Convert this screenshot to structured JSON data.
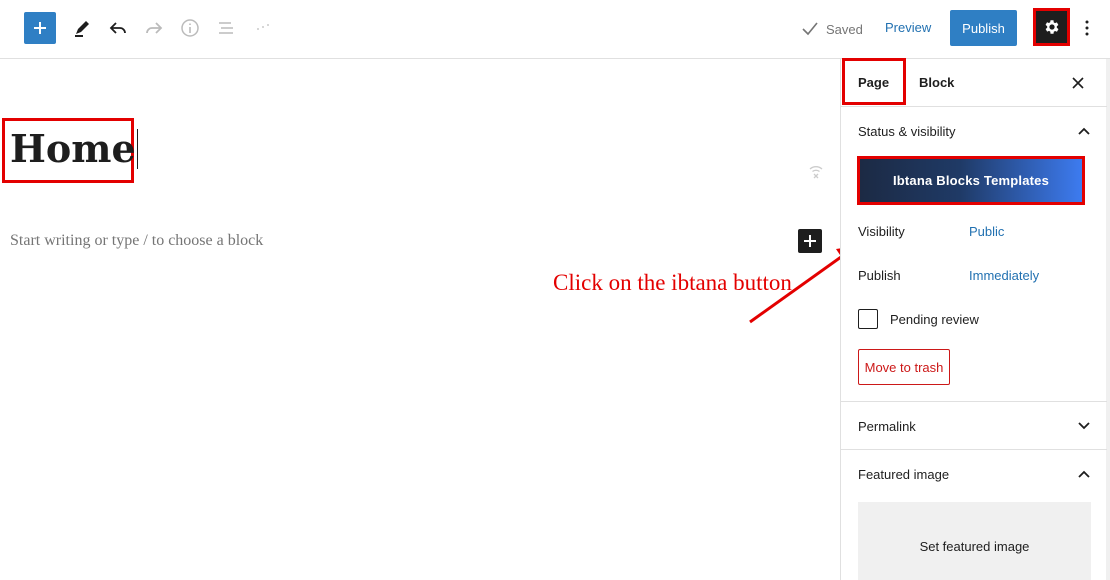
{
  "toolbar": {
    "saved_label": "Saved",
    "preview_label": "Preview",
    "publish_label": "Publish"
  },
  "editor": {
    "title": "Home",
    "placeholder": "Start writing or type / to choose a block"
  },
  "annotation": {
    "text": "Click on the ibtana button",
    "color": "#e30000"
  },
  "sidebar": {
    "tabs": [
      {
        "label": "Page",
        "active": true
      },
      {
        "label": "Block",
        "active": false
      }
    ],
    "status_panel": {
      "title": "Status & visibility",
      "ibtana_button": "Ibtana Blocks Templates",
      "visibility_label": "Visibility",
      "visibility_value": "Public",
      "publish_label": "Publish",
      "publish_value": "Immediately",
      "pending_review_label": "Pending review",
      "pending_review_checked": false,
      "trash_label": "Move to trash"
    },
    "permalink_panel": {
      "title": "Permalink"
    },
    "featured_panel": {
      "title": "Featured image",
      "set_label": "Set featured image"
    }
  },
  "colors": {
    "accent": "#2f7fc4",
    "link": "#2271b1",
    "highlight": "#e30000",
    "danger": "#cc1818"
  }
}
